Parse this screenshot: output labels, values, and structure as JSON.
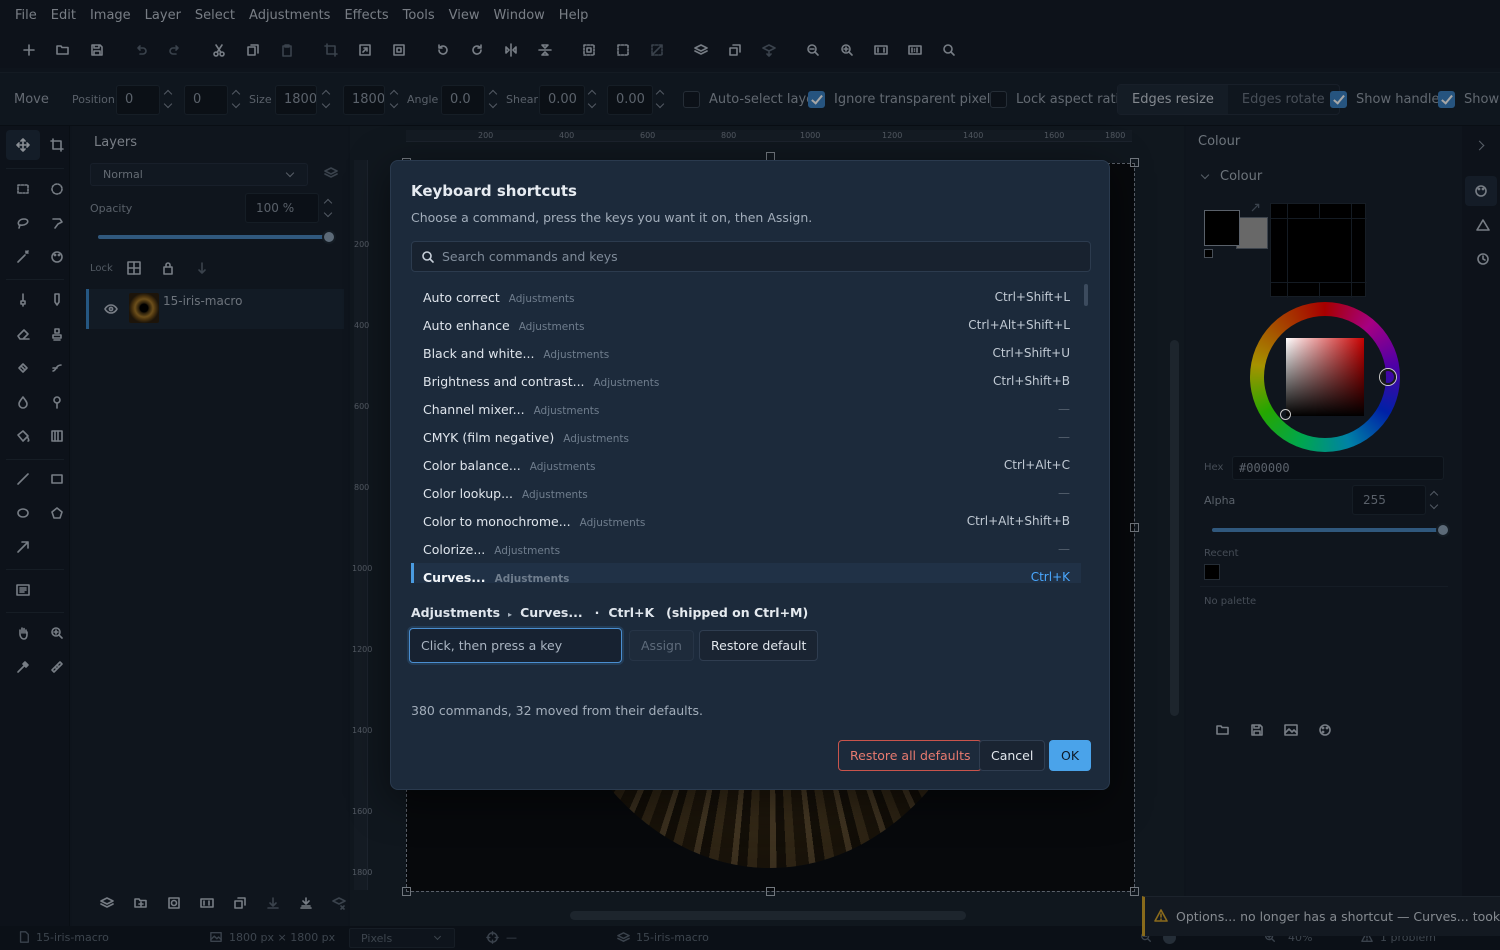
{
  "menu": [
    "File",
    "Edit",
    "Image",
    "Layer",
    "Select",
    "Adjustments",
    "Effects",
    "Tools",
    "View",
    "Window",
    "Help"
  ],
  "options_bar": {
    "tool": "Move",
    "position_label": "Position",
    "pos_x": "0",
    "pos_y": "0",
    "size_label": "Size",
    "size_w": "1800",
    "size_h": "1800",
    "angle_label": "Angle",
    "angle": "0.0",
    "shear_label": "Shear",
    "shear_x": "0.00",
    "shear_y": "0.00",
    "auto_select": "Auto-select layer",
    "ignore_transparent": "Ignore transparent pixels",
    "lock_aspect": "Lock aspect ratio",
    "edges_resize": "Edges resize",
    "edges_rotate": "Edges rotate",
    "show_handles": "Show handles",
    "show_other": "Show"
  },
  "layers": {
    "title": "Layers",
    "blend_mode": "Normal",
    "opacity_label": "Opacity",
    "opacity_value": "100 %",
    "opacity": 1.0,
    "lock_label": "Lock",
    "layer_name": "15-iris-macro"
  },
  "rulers": {
    "h": [
      "200",
      "400",
      "600",
      "800",
      "1000",
      "1200",
      "1400",
      "1600",
      "1800"
    ],
    "v": [
      "200",
      "400",
      "600",
      "800",
      "1000",
      "1200",
      "1400",
      "1600",
      "1800"
    ]
  },
  "colour": {
    "panel_title": "Colour",
    "section_title": "Colour",
    "hex_label": "Hex",
    "hex_value": "#000000",
    "alpha_label": "Alpha",
    "alpha_value": "255",
    "alpha": 1.0,
    "recent_label": "Recent",
    "no_palette": "No palette",
    "primary": "#000000",
    "secondary": "#a0a0a0"
  },
  "dialog": {
    "title": "Keyboard shortcuts",
    "subtitle": "Choose a command, press the keys you want it on, then Assign.",
    "search_placeholder": "Search commands and keys",
    "commands": [
      {
        "name": "Auto correct",
        "category": "Adjustments",
        "keys": "Ctrl+Shift+L"
      },
      {
        "name": "Auto enhance",
        "category": "Adjustments",
        "keys": "Ctrl+Alt+Shift+L"
      },
      {
        "name": "Black and white...",
        "category": "Adjustments",
        "keys": "Ctrl+Shift+U"
      },
      {
        "name": "Brightness and contrast...",
        "category": "Adjustments",
        "keys": "Ctrl+Shift+B"
      },
      {
        "name": "Channel mixer...",
        "category": "Adjustments",
        "keys": "—"
      },
      {
        "name": "CMYK (film negative)",
        "category": "Adjustments",
        "keys": "—"
      },
      {
        "name": "Color balance...",
        "category": "Adjustments",
        "keys": "Ctrl+Alt+C"
      },
      {
        "name": "Color lookup...",
        "category": "Adjustments",
        "keys": "—"
      },
      {
        "name": "Color to monochrome...",
        "category": "Adjustments",
        "keys": "Ctrl+Alt+Shift+B"
      },
      {
        "name": "Colorize...",
        "category": "Adjustments",
        "keys": "—"
      },
      {
        "name": "Curves...",
        "category": "Adjustments",
        "keys": "Ctrl+K",
        "selected": true
      }
    ],
    "breadcrumb_category": "Adjustments",
    "breadcrumb_command": "Curves...",
    "breadcrumb_dot": "·",
    "breadcrumb_keys": "Ctrl+K",
    "breadcrumb_shipped": "(shipped on Ctrl+M)",
    "key_placeholder": "Click, then press a key",
    "assign": "Assign",
    "restore_default": "Restore default",
    "count_text": "380 commands, 32 moved from their defaults.",
    "restore_all": "Restore all defaults",
    "cancel": "Cancel",
    "ok": "OK"
  },
  "status": {
    "doc": "15-iris-macro",
    "dims": "1800 px × 1800 px",
    "units": "Pixels",
    "cursor": "—",
    "layer": "15-iris-macro",
    "zoom": "40%",
    "problems": "1 problem"
  },
  "toast": {
    "message": "Options... no longer has a shortcut — Curves... took it."
  }
}
